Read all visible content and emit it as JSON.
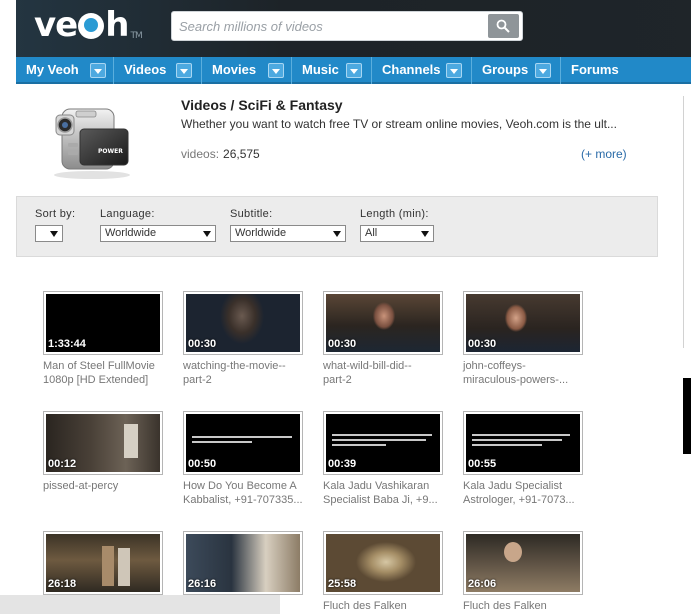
{
  "header": {
    "logo_text": "veoh",
    "logo_mark": "TM",
    "search_placeholder": "Search millions of videos",
    "search_icon": "search-icon"
  },
  "nav": [
    {
      "label": "My Veoh",
      "dropdown": true
    },
    {
      "label": "Videos",
      "dropdown": true
    },
    {
      "label": "Movies",
      "dropdown": true
    },
    {
      "label": "Music",
      "dropdown": true
    },
    {
      "label": "Channels",
      "dropdown": true
    },
    {
      "label": "Groups",
      "dropdown": true
    },
    {
      "label": "Forums",
      "dropdown": false
    }
  ],
  "category": {
    "title": "Videos / SciFi & Fantasy",
    "description": "Whether you want to watch free TV or stream online movies, Veoh.com is the ult...",
    "stats_label": "videos:",
    "video_count": "26,575",
    "more_link": "(+ more)",
    "icon": "camcorder-icon"
  },
  "filters": {
    "sort_label": "Sort by:",
    "sort_value": "",
    "language_label": "Language:",
    "language_value": "Worldwide",
    "subtitle_label": "Subtitle:",
    "subtitle_value": "Worldwide",
    "length_label": "Length (min):",
    "length_value": "All"
  },
  "videos": [
    {
      "duration": "1:33:44",
      "title_line1": "Man of Steel FullMovie",
      "title_line2": "1080p [HD Extended]"
    },
    {
      "duration": "00:30",
      "title_line1": "watching-the-movie--",
      "title_line2": "part-2"
    },
    {
      "duration": "00:30",
      "title_line1": "what-wild-bill-did--",
      "title_line2": "part-2"
    },
    {
      "duration": "00:30",
      "title_line1": "john-coffeys-",
      "title_line2": "miraculous-powers-..."
    },
    {
      "duration": "00:12",
      "title_line1": "pissed-at-percy",
      "title_line2": ""
    },
    {
      "duration": "00:50",
      "title_line1": "How Do You Become A",
      "title_line2": "Kabbalist, +91-707335..."
    },
    {
      "duration": "00:39",
      "title_line1": "Kala Jadu Vashikaran",
      "title_line2": "Specialist Baba Ji, +9..."
    },
    {
      "duration": "00:55",
      "title_line1": "Kala Jadu Specialist",
      "title_line2": "Astrologer, +91-7073..."
    },
    {
      "duration": "26:18",
      "title_line1": "",
      "title_line2": ""
    },
    {
      "duration": "26:16",
      "title_line1": "",
      "title_line2": ""
    },
    {
      "duration": "25:58",
      "title_line1": "Fluch des Falken",
      "title_line2": ""
    },
    {
      "duration": "26:06",
      "title_line1": "Fluch des Falken",
      "title_line2": ""
    }
  ]
}
